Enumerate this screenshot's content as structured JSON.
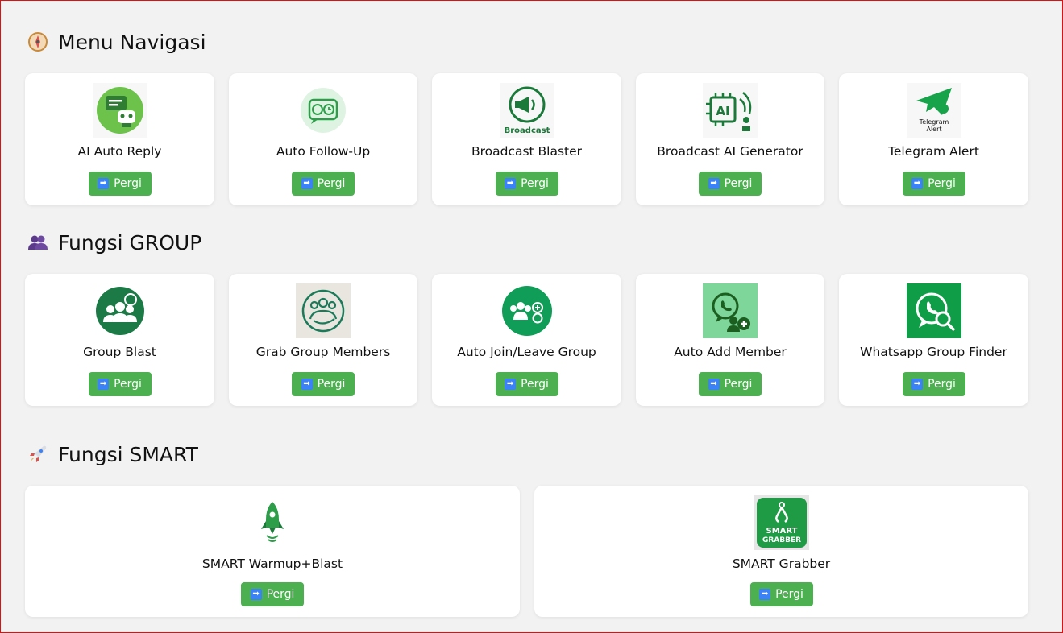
{
  "sections": [
    {
      "title": "Menu Navigasi",
      "emoji": "compass-icon",
      "cards": [
        {
          "label": "AI Auto Reply",
          "icon": "ai-auto-reply-icon"
        },
        {
          "label": "Auto Follow-Up",
          "icon": "auto-follow-up-icon"
        },
        {
          "label": "Broadcast Blaster",
          "icon": "broadcast-icon",
          "icon_text": "Broadcast"
        },
        {
          "label": "Broadcast AI Generator",
          "icon": "ai-chip-icon",
          "icon_text": "AI"
        },
        {
          "label": "Telegram Alert",
          "icon": "telegram-alert-icon",
          "icon_text": "Telegram Alert"
        }
      ]
    },
    {
      "title": "Fungsi GROUP",
      "emoji": "people-icon",
      "cards": [
        {
          "label": "Group Blast",
          "icon": "group-blast-icon"
        },
        {
          "label": "Grab Group Members",
          "icon": "grab-members-icon"
        },
        {
          "label": "Auto Join/Leave Group",
          "icon": "join-leave-icon"
        },
        {
          "label": "Auto Add Member",
          "icon": "add-member-icon"
        },
        {
          "label": "Whatsapp Group Finder",
          "icon": "group-finder-icon"
        }
      ]
    },
    {
      "title": "Fungsi SMART",
      "emoji": "rocket-icon",
      "cards": [
        {
          "label": "SMART Warmup+Blast",
          "icon": "rocket-icon"
        },
        {
          "label": "SMART Grabber",
          "icon": "smart-grabber-icon",
          "icon_text": "SMART GRABBER"
        }
      ]
    }
  ],
  "button_label": "Pergi",
  "button_icon": "arrow-right-icon",
  "colors": {
    "button": "#4caf50",
    "accent_green": "#0f9d58",
    "background": "#f2f2f2"
  }
}
